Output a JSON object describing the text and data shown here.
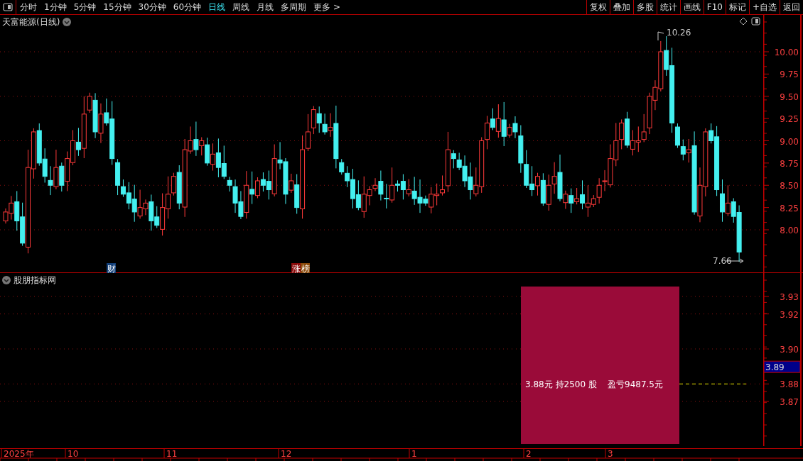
{
  "toolbar": {
    "layout_toggle": true,
    "periods": [
      {
        "label": "分时",
        "selected": false
      },
      {
        "label": "1分钟",
        "selected": false
      },
      {
        "label": "5分钟",
        "selected": false
      },
      {
        "label": "15分钟",
        "selected": false
      },
      {
        "label": "30分钟",
        "selected": false
      },
      {
        "label": "60分钟",
        "selected": false
      },
      {
        "label": "日线",
        "selected": true
      },
      {
        "label": "周线",
        "selected": false
      },
      {
        "label": "月线",
        "selected": false
      },
      {
        "label": "多周期",
        "selected": false
      },
      {
        "label": "更多 >",
        "selected": false
      }
    ],
    "actions": [
      "复权",
      "叠加",
      "多股",
      "统计",
      "画线",
      "F10",
      "标记",
      "+自选",
      "返回"
    ]
  },
  "main_chart": {
    "title": "天富能源(日线)",
    "y_ticks": [
      "10.00",
      "9.75",
      "9.50",
      "9.25",
      "9.00",
      "8.75",
      "8.50",
      "8.25",
      "8.00"
    ],
    "high_label": "10.26",
    "low_label": "7.66",
    "markers": [
      {
        "chars": [
          {
            "text": "财",
            "color": "#123f78"
          }
        ]
      },
      {
        "chars": [
          {
            "text": "涨",
            "color": "#8a0a0a"
          },
          {
            "text": "榜",
            "color": "#8a4a0a"
          }
        ]
      }
    ]
  },
  "indicator": {
    "title": "股朋指标网",
    "y_ticks": [
      "3.93",
      "3.92",
      "3.90",
      "3.88",
      "3.87"
    ],
    "current_value": "3.89",
    "position_text": "3.88元 持2500 股",
    "pnl_text": "盈亏9487.5元"
  },
  "time_axis": {
    "labels": [
      "2025年",
      "10",
      "11",
      "12",
      "1",
      "2",
      "3"
    ]
  }
}
